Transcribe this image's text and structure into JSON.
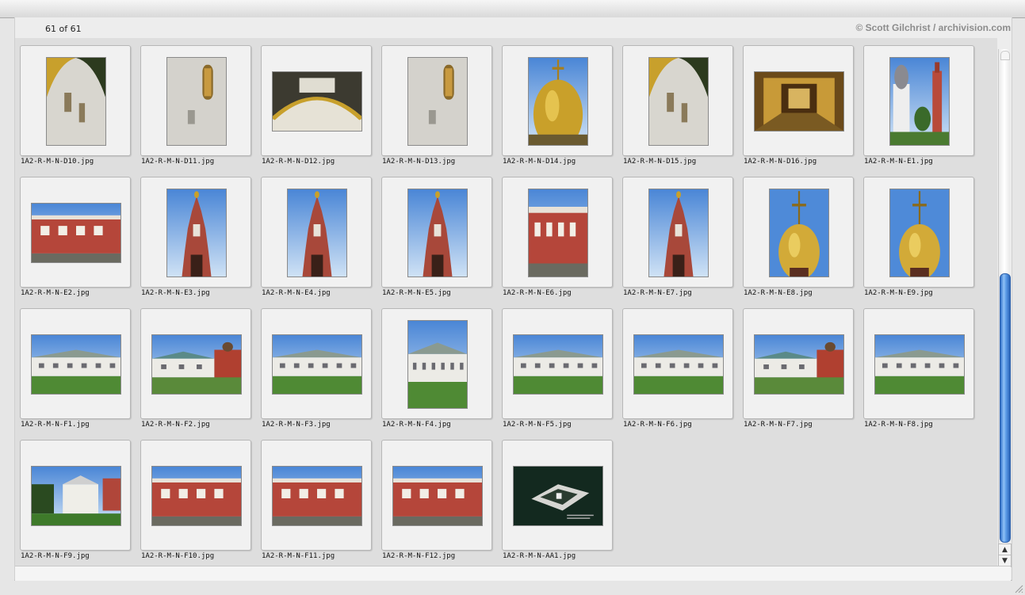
{
  "header": {
    "count_text": "61 of 61",
    "credit_text": "© Scott Gilchrist / archivision.com"
  },
  "scrollbar": {
    "up_icon": "arrow-up-icon",
    "down_icon": "arrow-down-icon",
    "accent": "#3b7fd8"
  },
  "items": [
    {
      "label": "1A2-R-M-N-D10.jpg",
      "orientation": "portrait",
      "scene": "dome-detail"
    },
    {
      "label": "1A2-R-M-N-D11.jpg",
      "orientation": "portrait",
      "scene": "wall-detail"
    },
    {
      "label": "1A2-R-M-N-D12.jpg",
      "orientation": "landscape",
      "scene": "arch-detail"
    },
    {
      "label": "1A2-R-M-N-D13.jpg",
      "orientation": "portrait",
      "scene": "wall-detail"
    },
    {
      "label": "1A2-R-M-N-D14.jpg",
      "orientation": "portrait",
      "scene": "gold-dome"
    },
    {
      "label": "1A2-R-M-N-D15.jpg",
      "orientation": "portrait",
      "scene": "dome-detail"
    },
    {
      "label": "1A2-R-M-N-D16.jpg",
      "orientation": "landscape",
      "scene": "interior"
    },
    {
      "label": "1A2-R-M-N-E1.jpg",
      "orientation": "portrait",
      "scene": "church-tower"
    },
    {
      "label": "1A2-R-M-N-E2.jpg",
      "orientation": "landscape",
      "scene": "red-building"
    },
    {
      "label": "1A2-R-M-N-E3.jpg",
      "orientation": "portrait",
      "scene": "bell-tower"
    },
    {
      "label": "1A2-R-M-N-E4.jpg",
      "orientation": "portrait",
      "scene": "bell-tower"
    },
    {
      "label": "1A2-R-M-N-E5.jpg",
      "orientation": "portrait",
      "scene": "bell-tower"
    },
    {
      "label": "1A2-R-M-N-E6.jpg",
      "orientation": "portrait",
      "scene": "red-building"
    },
    {
      "label": "1A2-R-M-N-E7.jpg",
      "orientation": "portrait",
      "scene": "bell-tower"
    },
    {
      "label": "1A2-R-M-N-E8.jpg",
      "orientation": "portrait",
      "scene": "gold-dome-sky"
    },
    {
      "label": "1A2-R-M-N-E9.jpg",
      "orientation": "portrait",
      "scene": "gold-dome-sky"
    },
    {
      "label": "1A2-R-M-N-F1.jpg",
      "orientation": "landscape",
      "scene": "white-building"
    },
    {
      "label": "1A2-R-M-N-F2.jpg",
      "orientation": "landscape",
      "scene": "white-building-red"
    },
    {
      "label": "1A2-R-M-N-F3.jpg",
      "orientation": "landscape",
      "scene": "white-building"
    },
    {
      "label": "1A2-R-M-N-F4.jpg",
      "orientation": "portrait",
      "scene": "white-building"
    },
    {
      "label": "1A2-R-M-N-F5.jpg",
      "orientation": "landscape",
      "scene": "white-building"
    },
    {
      "label": "1A2-R-M-N-F6.jpg",
      "orientation": "landscape",
      "scene": "white-building"
    },
    {
      "label": "1A2-R-M-N-F7.jpg",
      "orientation": "landscape",
      "scene": "white-building-red"
    },
    {
      "label": "1A2-R-M-N-F8.jpg",
      "orientation": "landscape",
      "scene": "white-building"
    },
    {
      "label": "1A2-R-M-N-F9.jpg",
      "orientation": "landscape",
      "scene": "pavilion"
    },
    {
      "label": "1A2-R-M-N-F10.jpg",
      "orientation": "landscape",
      "scene": "red-building"
    },
    {
      "label": "1A2-R-M-N-F11.jpg",
      "orientation": "landscape",
      "scene": "red-building"
    },
    {
      "label": "1A2-R-M-N-F12.jpg",
      "orientation": "landscape",
      "scene": "red-building"
    },
    {
      "label": "1A2-R-M-N-AA1.jpg",
      "orientation": "landscape",
      "scene": "plan"
    }
  ]
}
